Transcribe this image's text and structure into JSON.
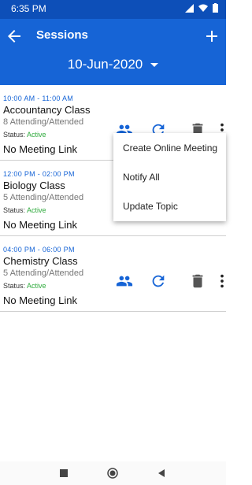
{
  "status_bar": {
    "time": "6:35 PM"
  },
  "app_bar": {
    "title": "Sessions",
    "date": "10-Jun-2020"
  },
  "sessions": [
    {
      "time": "10:00 AM - 11:00 AM",
      "name": "Accountancy Class",
      "attending": "8 Attending/Attended",
      "status_label": "Status:",
      "status_value": "Active",
      "link": "No Meeting Link"
    },
    {
      "time": "12:00 PM - 02:00 PM",
      "name": "Biology Class",
      "attending": "5 Attending/Attended",
      "status_label": "Status:",
      "status_value": "Active",
      "link": "No Meeting Link"
    },
    {
      "time": "04:00 PM - 06:00 PM",
      "name": "Chemistry Class",
      "attending": "5 Attending/Attended",
      "status_label": "Status:",
      "status_value": "Active",
      "link": "No Meeting Link"
    }
  ],
  "menu": {
    "items": [
      "Create Online Meeting",
      "Notify All",
      "Update Topic"
    ]
  },
  "icons": [
    "back-arrow-icon",
    "add-icon",
    "people-icon",
    "refresh-icon",
    "delete-icon",
    "more-vert-icon"
  ],
  "colors": {
    "primary": "#1664d6",
    "status_active": "#2eaa3c"
  }
}
